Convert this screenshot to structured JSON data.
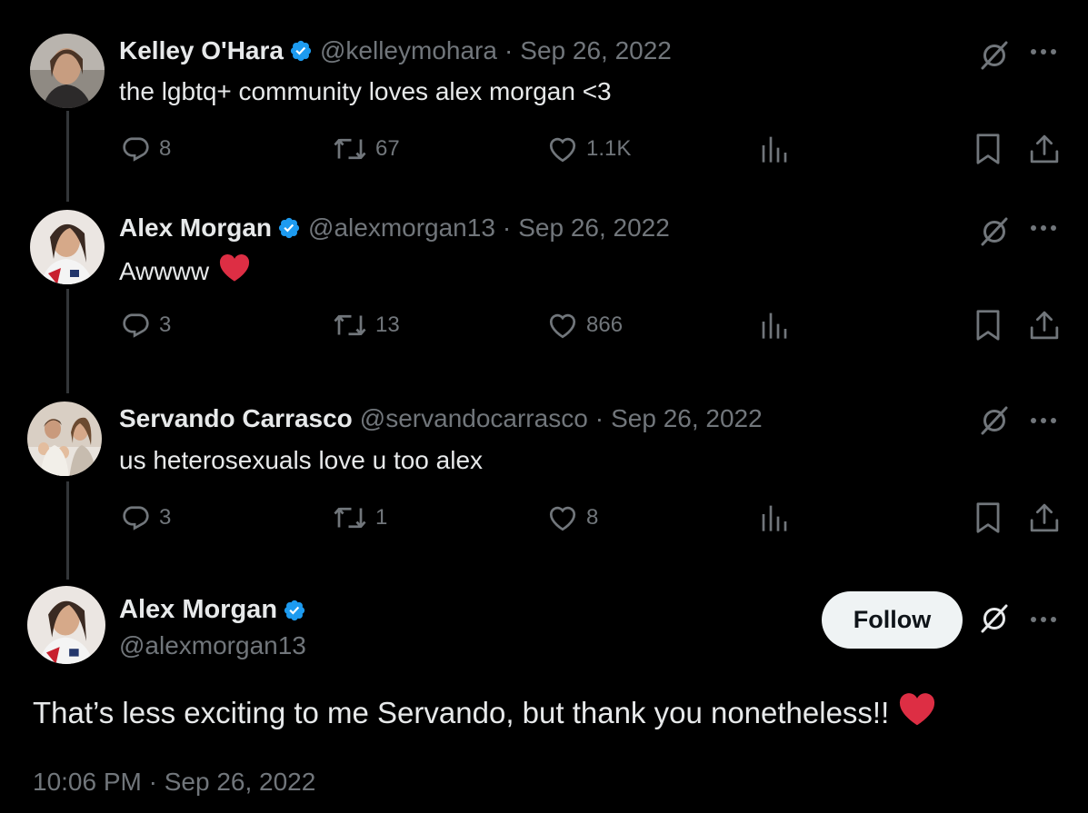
{
  "tweets": [
    {
      "name": "Kelley O'Hara",
      "verified": true,
      "handle": "@kelleymohara",
      "separator": "·",
      "date": "Sep 26, 2022",
      "text": "the lgbtq+ community loves alex morgan <3",
      "replies": "8",
      "reposts": "67",
      "likes": "1.1K"
    },
    {
      "name": "Alex Morgan",
      "verified": true,
      "handle": "@alexmorgan13",
      "separator": "·",
      "date": "Sep 26, 2022",
      "text": "Awwww",
      "replies": "3",
      "reposts": "13",
      "likes": "866"
    },
    {
      "name": "Servando Carrasco",
      "verified": false,
      "handle": "@servandocarrasco",
      "separator": "·",
      "date": "Sep 26, 2022",
      "text": "us heterosexuals love u too alex",
      "replies": "3",
      "reposts": "1",
      "likes": "8"
    }
  ],
  "main_tweet": {
    "name": "Alex Morgan",
    "verified": true,
    "handle": "@alexmorgan13",
    "follow_label": "Follow",
    "text": "That’s less exciting to me Servando, but thank you nonetheless!!",
    "timestamp": "10:06 PM · Sep 26, 2022"
  },
  "colors": {
    "background": "#000000",
    "text": "#e7e9ea",
    "secondary": "#71767b",
    "verified": "#1d9bf0",
    "heart_emoji": "#dd2e44"
  },
  "icons": [
    "reply-icon",
    "repost-icon",
    "like-icon",
    "views-icon",
    "bookmark-icon",
    "share-icon",
    "grok-icon",
    "more-icon",
    "verified-badge-icon",
    "red-heart-emoji"
  ]
}
